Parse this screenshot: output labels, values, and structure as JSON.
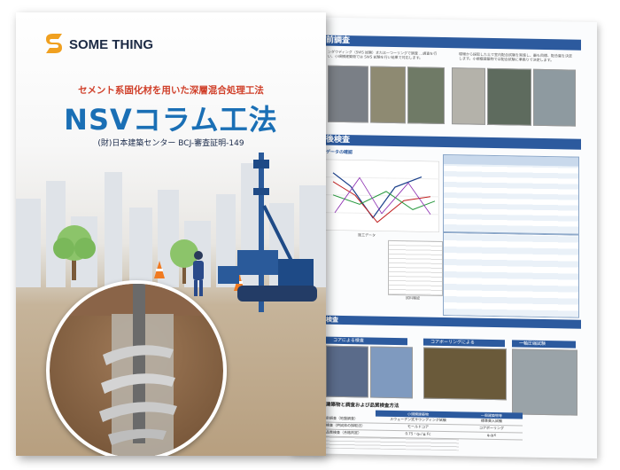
{
  "cover": {
    "brand_name": "SOME THING",
    "subtitle": "セメント系固化材を用いた深層混合処理工法",
    "title": "NSVコラム工法",
    "certification": "(財)日本建築センター BCJ-審査証明-149"
  },
  "back_page": {
    "section1_title": "前調査",
    "section2_title": "後検査",
    "subsection_label": "データの確認",
    "section3_title": "検査",
    "photo_caption_1": "コアによる検査",
    "photo_caption_2": "コアボーリングによる",
    "photo_caption_3": "一軸圧縮試験",
    "table_title": "建築物と調査および品質検査方法",
    "table_headers": [
      "小規模建築物",
      "一般建築物等"
    ],
    "table_rows": [
      [
        "前調査（地盤調査）",
        "スウェーデン式サウンディング試験",
        "標準貫入試験"
      ],
      [
        "検査（供試体の採取法）",
        "モールドコア",
        "コアボーリング"
      ],
      [
        "品質検査（合格判定）",
        "0.75・qₑᵤᶠ≧ Fc",
        "qᵤ≧X"
      ]
    ],
    "chart_caption_1": "施工データ",
    "chart_caption_2": "試料確認"
  },
  "colors": {
    "band": "#2c5a9e",
    "title_blue": "#1a6fb5",
    "subtitle_red": "#d0402a",
    "logo_orange": "#f0a020"
  }
}
